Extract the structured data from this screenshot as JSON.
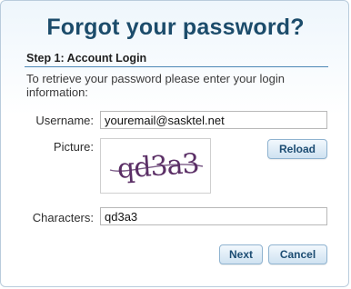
{
  "dialog": {
    "title": "Forgot your password?",
    "step_label": "Step 1: Account Login",
    "instructions": "To retrieve your password please enter your login information:"
  },
  "form": {
    "username_label": "Username:",
    "username_value": "youremail@sasktel.net",
    "picture_label": "Picture:",
    "captcha_text": "qd3a3",
    "reload_label": "Reload",
    "characters_label": "Characters:",
    "characters_value": "qd3a3"
  },
  "actions": {
    "next_label": "Next",
    "cancel_label": "Cancel"
  },
  "colors": {
    "title": "#1c4c6b",
    "accent_rule": "#4c87b5",
    "captcha_ink": "#5b2f66"
  }
}
